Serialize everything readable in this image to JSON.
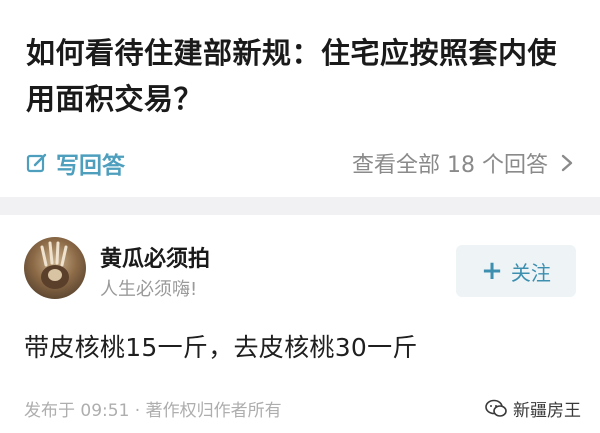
{
  "question": {
    "title": "如何看待住建部新规：住宅应按照套内使用面积交易？",
    "write_answer_label": "写回答",
    "view_all_label": "查看全部 18 个回答"
  },
  "answer": {
    "author_name": "黄瓜必须拍",
    "author_bio": "人生必须嗨!",
    "follow_label": "关注",
    "content": "带皮核桃15一斤，去皮核桃30一斤",
    "meta": "发布于 09:51 · 著作权归作者所有"
  },
  "watermark": {
    "text": "新疆房王"
  },
  "colors": {
    "accent": "#4e9fbe",
    "follow_bg": "#eef4f6",
    "divider": "#f1f1f3"
  }
}
